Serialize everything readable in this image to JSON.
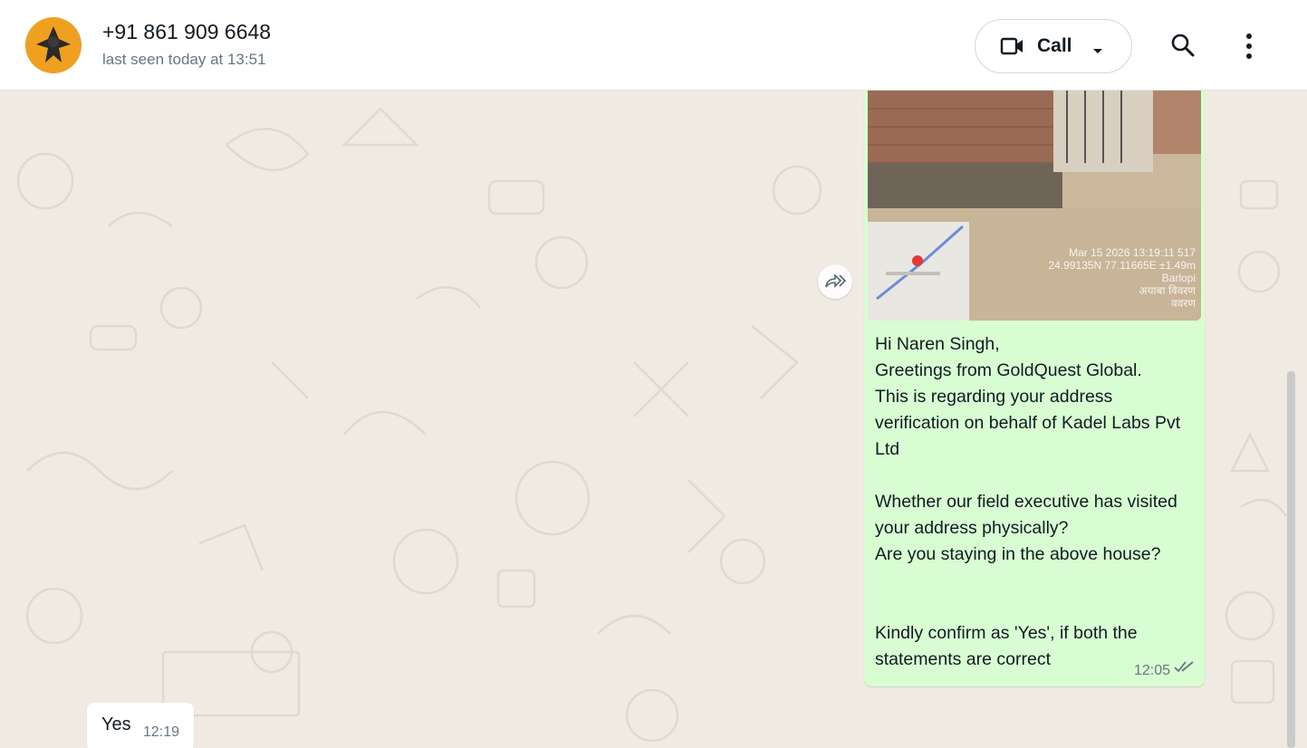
{
  "header": {
    "contact_name": "+91 861 909 6648",
    "last_seen": "last seen today at 13:51",
    "call_label": "Call"
  },
  "icons": [
    "video-camera-icon",
    "chevron-down-icon",
    "search-icon",
    "more-vertical-icon",
    "forward-icon",
    "double-check-icon"
  ],
  "messages": [
    {
      "direction": "outgoing",
      "image_stamp": [
        "Mar 15 2026 13:19:11 517",
        "24.99135N 77.11665E ±1.49m",
        "Barlopi",
        "अयाबा विवरण",
        "ववरण"
      ],
      "text": "Hi Naren Singh,\nGreetings from GoldQuest Global.\nThis is regarding your address verification on behalf of Kadel Labs Pvt Ltd\n\nWhether our field executive has visited your address physically?\nAre you staying in the above house?\n\n\nKindly confirm as 'Yes', if both the statements are correct",
      "time": "12:05",
      "status": "read"
    },
    {
      "direction": "incoming",
      "text": "Yes",
      "time": "12:19"
    }
  ],
  "colors": {
    "outgoing_bubble": "#d9fdd3",
    "incoming_bubble": "#ffffff",
    "chat_background": "#efeae2",
    "read_tick": "#667781"
  }
}
